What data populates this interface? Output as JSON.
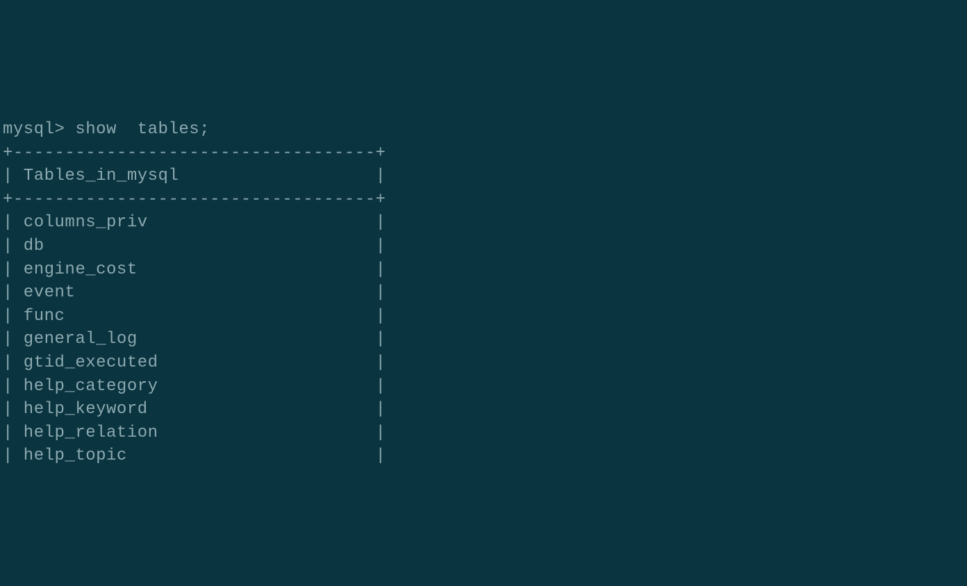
{
  "prompt": "mysql> ",
  "command": "show  tables;",
  "border_top": "+-----------------------------------+",
  "header_line": "| Tables_in_mysql                   |",
  "border_mid": "+-----------------------------------+",
  "rows": [
    "| columns_priv                      |",
    "| db                                |",
    "| engine_cost                       |",
    "| event                             |",
    "| func                              |",
    "| general_log                       |",
    "| gtid_executed                     |",
    "| help_category                     |",
    "| help_keyword                      |",
    "| help_relation                     |",
    "| help_topic                        |"
  ]
}
